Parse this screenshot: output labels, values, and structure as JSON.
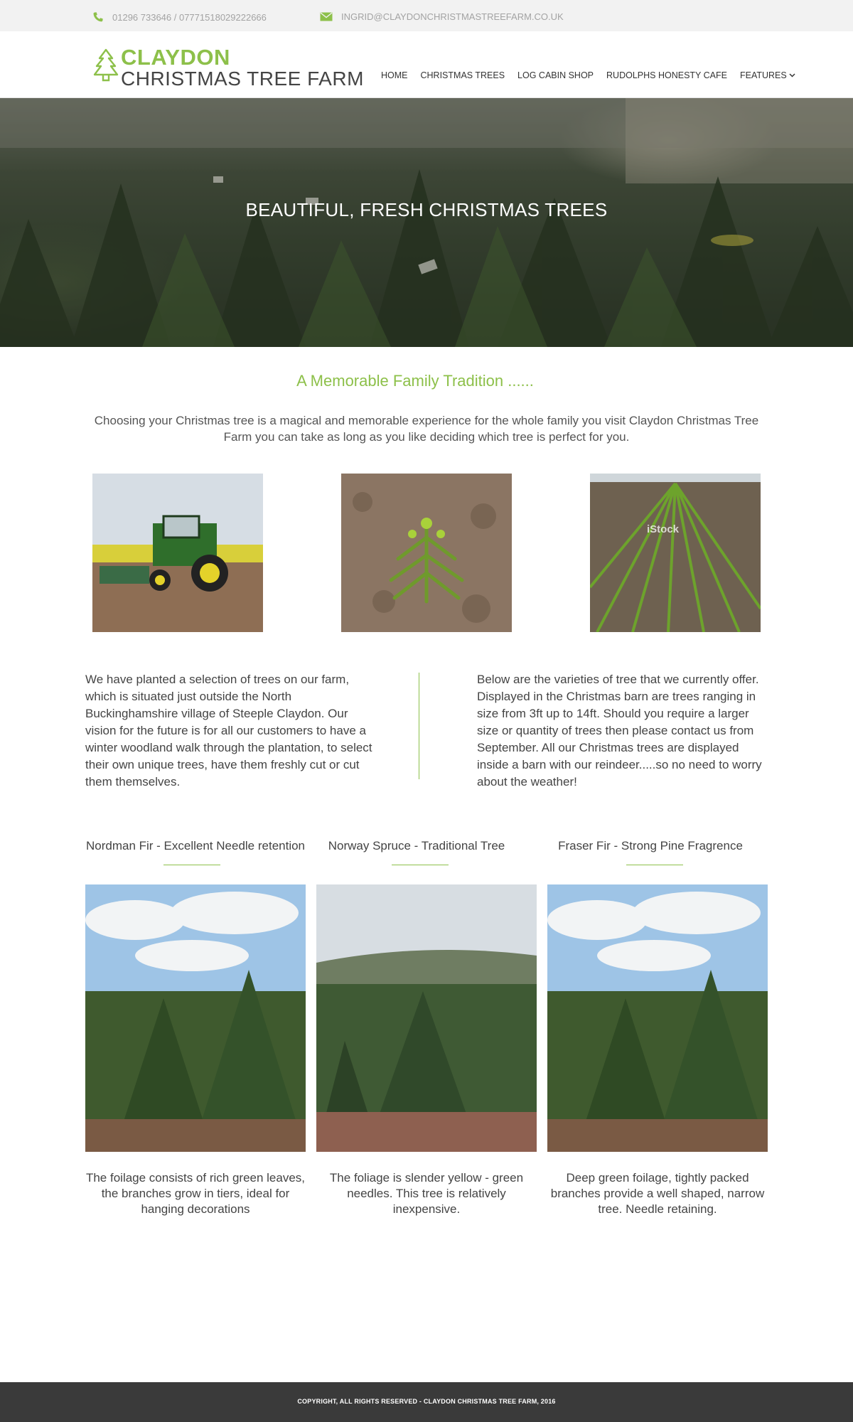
{
  "topbar": {
    "phone": "01296 733646 / 07771518029222666",
    "email": "INGRID@CLAYDONCHRISTMASTREEFARM.CO.UK",
    "phone_icon": "phone-icon",
    "email_icon": "envelope-icon"
  },
  "logo": {
    "line1": "CLAYDON",
    "line2": "CHRISTMAS TREE FARM",
    "icon": "tree-icon"
  },
  "nav": {
    "items": [
      "HOME",
      "CHRISTMAS TREES",
      "LOG CABIN SHOP",
      "RUDOLPHS HONESTY CAFE",
      "FEATURES"
    ],
    "dropdown_icon": "chevron-down-icon"
  },
  "hero": {
    "title": "BEAUTIFUL, FRESH CHRISTMAS TREES"
  },
  "intro": {
    "title": "A Memorable Family Tradition ......",
    "text": "Choosing your Christmas tree is a magical and memorable experience for the whole family you visit Claydon Christmas Tree Farm you can take as long as you like deciding which tree is perfect for you."
  },
  "photos": {
    "watermark": "iStock"
  },
  "columns": {
    "left": "We have planted a selection of trees on our farm, which is situated just outside the North Buckinghamshire village of Steeple Claydon.  Our vision for the future is for all our customers to have a winter woodland walk through the plantation, to select their own unique trees, have them freshly cut or cut them themselves.",
    "right": "Below  are the varieties of tree that we currently offer.  Displayed in the Christmas barn are trees ranging in size from 3ft up to 14ft.  Should you require a larger size or quantity of trees then please contact us from September.  All our Christmas trees are displayed inside a barn with our reindeer.....so no need to worry about the weather!"
  },
  "varieties": [
    {
      "title": "Nordman Fir - Excellent Needle retention",
      "desc": "The foilage consists of rich green leaves, the branches grow in tiers, ideal for hanging decorations"
    },
    {
      "title": "Norway Spruce - Traditional Tree",
      "desc": "The foliage is slender yellow - green needles. This tree is relatively inexpensive."
    },
    {
      "title": "Fraser Fir - Strong Pine Fragrence",
      "desc": "Deep green foilage, tightly packed branches provide a well shaped, narrow tree. Needle retaining."
    }
  ],
  "footer": {
    "text": "COPYRIGHT, ALL RIGHTS RESERVED - CLAYDON CHRISTMAS TREE FARM, 2016"
  },
  "colors": {
    "accent": "#8dc04a",
    "footer_bg": "#3a3a3a",
    "topbar_bg": "#f2f2f2"
  }
}
